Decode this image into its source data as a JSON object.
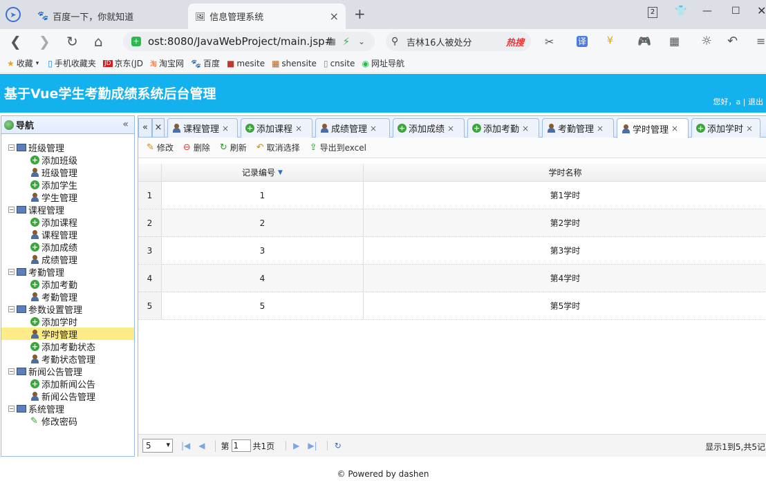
{
  "browser": {
    "tabs": [
      {
        "label": "百度一下，你就知道"
      },
      {
        "label": "信息管理系统"
      }
    ],
    "url": "ost:8080/JavaWebProject/main.jsp#",
    "search": "吉林16人被处分",
    "search_hot": "热搜",
    "tab_count": "2",
    "bookmarks": [
      {
        "label": "收藏"
      },
      {
        "label": "手机收藏夹"
      },
      {
        "label": "京东(JD"
      },
      {
        "label": "淘宝网"
      },
      {
        "label": "百度"
      },
      {
        "label": "mesite"
      },
      {
        "label": "shensite"
      },
      {
        "label": "cnsite"
      },
      {
        "label": "网址导航"
      }
    ]
  },
  "header": {
    "title": "基于Vue学生考勤成绩系统后台管理",
    "user": "您好，a | 退出"
  },
  "west": {
    "title": "导航",
    "tree": [
      {
        "label": "班级管理",
        "kind": "group"
      },
      {
        "label": "添加班级",
        "kind": "add"
      },
      {
        "label": "班级管理",
        "kind": "user"
      },
      {
        "label": "添加学生",
        "kind": "add"
      },
      {
        "label": "学生管理",
        "kind": "user"
      },
      {
        "label": "课程管理",
        "kind": "group"
      },
      {
        "label": "添加课程",
        "kind": "add"
      },
      {
        "label": "课程管理",
        "kind": "user"
      },
      {
        "label": "添加成绩",
        "kind": "add"
      },
      {
        "label": "成绩管理",
        "kind": "user"
      },
      {
        "label": "考勤管理",
        "kind": "group"
      },
      {
        "label": "添加考勤",
        "kind": "add"
      },
      {
        "label": "考勤管理",
        "kind": "user"
      },
      {
        "label": "参数设置管理",
        "kind": "group"
      },
      {
        "label": "添加学时",
        "kind": "add"
      },
      {
        "label": "学时管理",
        "kind": "user",
        "selected": true
      },
      {
        "label": "添加考勤状态",
        "kind": "add"
      },
      {
        "label": "考勤状态管理",
        "kind": "user"
      },
      {
        "label": "新闻公告管理",
        "kind": "group"
      },
      {
        "label": "添加新闻公告",
        "kind": "add"
      },
      {
        "label": "新闻公告管理",
        "kind": "user"
      },
      {
        "label": "系统管理",
        "kind": "group"
      },
      {
        "label": "修改密码",
        "kind": "pen"
      }
    ]
  },
  "tabs": [
    {
      "label": "课程管理",
      "kind": "user"
    },
    {
      "label": "添加课程",
      "kind": "add"
    },
    {
      "label": "成绩管理",
      "kind": "user"
    },
    {
      "label": "添加成绩",
      "kind": "add"
    },
    {
      "label": "添加考勤",
      "kind": "add"
    },
    {
      "label": "考勤管理",
      "kind": "user"
    },
    {
      "label": "学时管理",
      "kind": "user",
      "active": true
    },
    {
      "label": "添加学时",
      "kind": "add"
    }
  ],
  "toolbar": {
    "edit": "修改",
    "delete": "删除",
    "refresh": "刷新",
    "cancel": "取消选择",
    "export": "导出到excel"
  },
  "grid": {
    "columns": [
      "记录编号",
      "学时名称"
    ],
    "rows": [
      {
        "n": "1",
        "id": "1",
        "name": "第1学时"
      },
      {
        "n": "2",
        "id": "2",
        "name": "第2学时"
      },
      {
        "n": "3",
        "id": "3",
        "name": "第3学时"
      },
      {
        "n": "4",
        "id": "4",
        "name": "第4学时"
      },
      {
        "n": "5",
        "id": "5",
        "name": "第5学时"
      }
    ]
  },
  "pager": {
    "size": "5",
    "page_prefix": "第",
    "page": "1",
    "page_suffix": "共1页",
    "info": "显示1到5,共5记"
  },
  "footer": "© Powered by dashen"
}
